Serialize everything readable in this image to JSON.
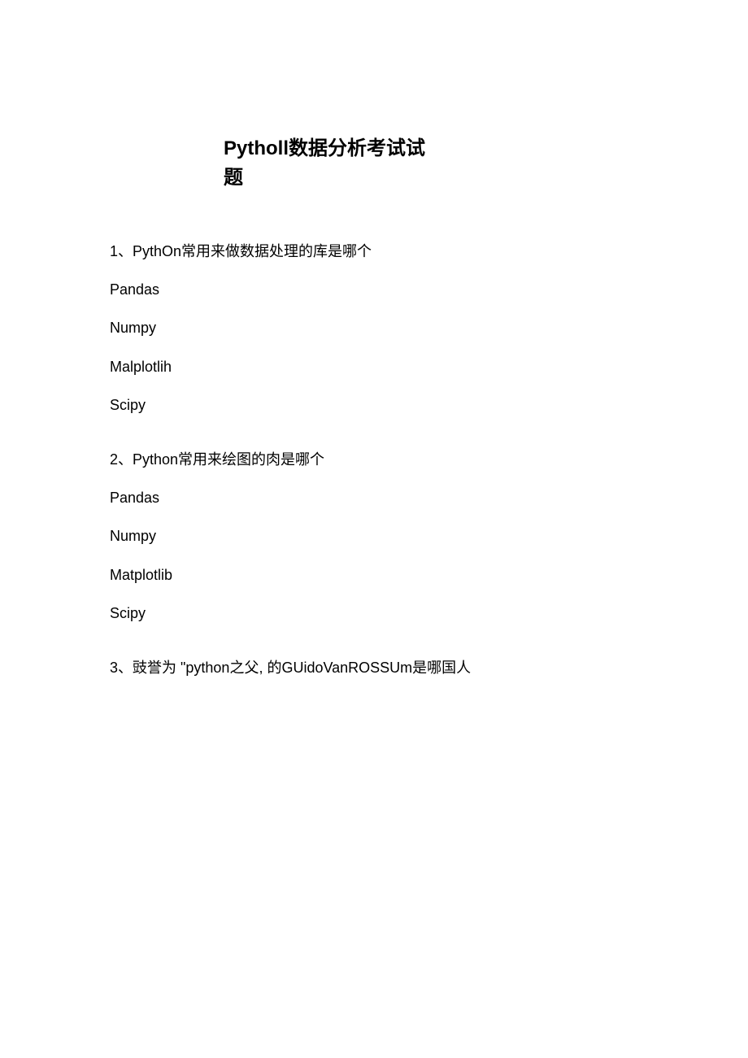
{
  "title": {
    "line1": "Pytholl数据分析考试试",
    "line2": "题"
  },
  "questions": [
    {
      "text": "1、PythOn常用来做数据处理的库是哪个",
      "options": [
        "Pandas",
        "Numpy",
        "Malplotlih",
        "Scipy"
      ]
    },
    {
      "text": "2、Python常用来绘图的肉是哪个",
      "options": [
        "Pandas",
        "Numpy",
        "Matplotlib",
        "Scipy"
      ]
    },
    {
      "text": "3、豉誉为 \"python之父, 的GUidoVanROSSUm是哪国人",
      "options": []
    }
  ]
}
